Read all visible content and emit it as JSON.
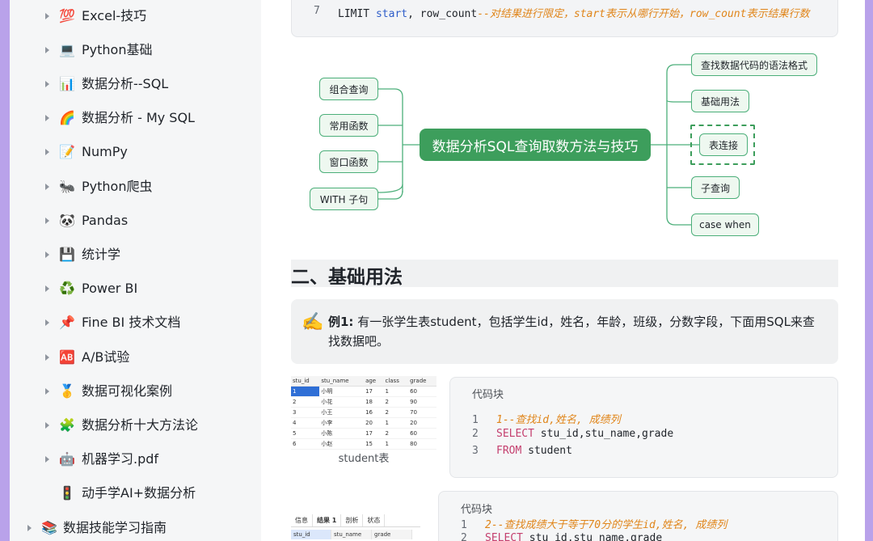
{
  "sidebar": {
    "items": [
      {
        "icon": "💯",
        "label": "Excel-技巧"
      },
      {
        "icon": "💻",
        "label": "Python基础"
      },
      {
        "icon": "📊",
        "label": "数据分析--SQL"
      },
      {
        "icon": "🌈",
        "label": "数据分析 - My SQL"
      },
      {
        "icon": "📝",
        "label": "NumPy"
      },
      {
        "icon": "🐜",
        "label": "Python爬虫"
      },
      {
        "icon": "🐼",
        "label": "Pandas"
      },
      {
        "icon": "💾",
        "label": "统计学"
      },
      {
        "icon": "♻️",
        "label": "Power BI"
      },
      {
        "icon": "📌",
        "label": "Fine BI 技术文档"
      },
      {
        "icon": "🆎",
        "label": "A/B试验"
      },
      {
        "icon": "🥇",
        "label": "数据可视化案例"
      },
      {
        "icon": "🧩",
        "label": "数据分析十大方法论"
      },
      {
        "icon": "🤖",
        "label": "机器学习.pdf"
      },
      {
        "icon": "🚦",
        "label": "动手学AI+数据分析"
      }
    ],
    "section": {
      "icon": "📚",
      "label": "数据技能学习指南"
    }
  },
  "top_code": {
    "line": "7",
    "kw": "LIMIT",
    "a": "start",
    "sep": ",",
    "b": "row_count",
    "comment": "--对结果进行限定，start表示从哪行开始，row_count表示结果行数"
  },
  "mindmap": {
    "center": "数据分析SQL查询取数方法与技巧",
    "left": [
      "组合查询",
      "常用函数",
      "窗口函数",
      "WITH 子句"
    ],
    "right": [
      "查找数据代码的语法格式",
      "基础用法",
      "表连接",
      "子查询",
      "case when"
    ]
  },
  "section_heading": "二、基础用法",
  "callout": {
    "icon": "✍️",
    "bold": "例1:",
    "text": "有一张学生表student，包括学生id，姓名，年龄，班级，分数字段，下面用SQL来查找数据吧。"
  },
  "student_table": {
    "columns": [
      "stu_id",
      "stu_name",
      "age",
      "class",
      "grade"
    ],
    "rows": [
      [
        "1",
        "小明",
        "17",
        "1",
        "60"
      ],
      [
        "2",
        "小花",
        "18",
        "2",
        "90"
      ],
      [
        "3",
        "小王",
        "16",
        "2",
        "70"
      ],
      [
        "4",
        "小李",
        "20",
        "1",
        "20"
      ],
      [
        "5",
        "小陈",
        "17",
        "2",
        "60"
      ],
      [
        "6",
        "小赵",
        "15",
        "1",
        "80"
      ]
    ],
    "caption": "student表"
  },
  "code_block_1": {
    "title": "代码块",
    "lines": [
      {
        "n": "1",
        "comment": "1--查找id,姓名, 成绩列"
      },
      {
        "n": "2",
        "kw": "SELECT",
        "rest": " stu_id,stu_name,grade"
      },
      {
        "n": "3",
        "kw": "FROM",
        "rest": " student"
      }
    ]
  },
  "result_panel": {
    "tabs": [
      "信息",
      "结果 1",
      "剖析",
      "状态"
    ],
    "columns": [
      "stu_id",
      "stu_name",
      "grade"
    ]
  },
  "code_block_2": {
    "title": "代码块",
    "lines": [
      {
        "n": "1",
        "comment": "2--查找成绩大于等于70分的学生id,姓名, 成绩列"
      },
      {
        "n": "2",
        "kw": "SELECT",
        "rest": " stu_id,stu_name,grade"
      }
    ]
  },
  "colors": {
    "accent_green": "#3d9e5c",
    "node_border": "#4caf7a",
    "keyword": "#c43f6e",
    "comment": "#e0851a",
    "frame": "#c9b8ef"
  }
}
